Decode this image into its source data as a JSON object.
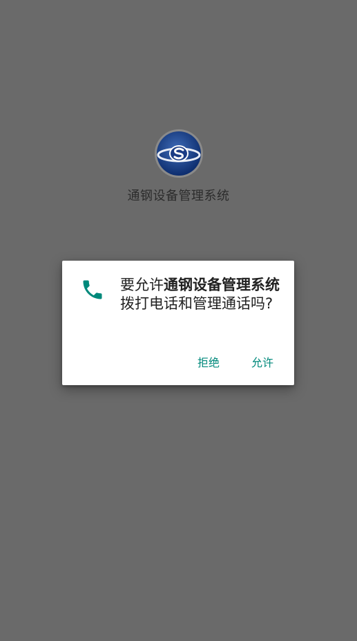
{
  "splash": {
    "app_name": "通钢设备管理系统",
    "logo_icon": "app-logo-icon"
  },
  "dialog": {
    "icon": "phone-icon",
    "message_prefix": "要允许",
    "message_app": "通钢设备管理系统",
    "message_suffix": "拨打电话和管理通话吗?",
    "deny_label": "拒绝",
    "allow_label": "允许",
    "accent_color": "#00897b"
  }
}
